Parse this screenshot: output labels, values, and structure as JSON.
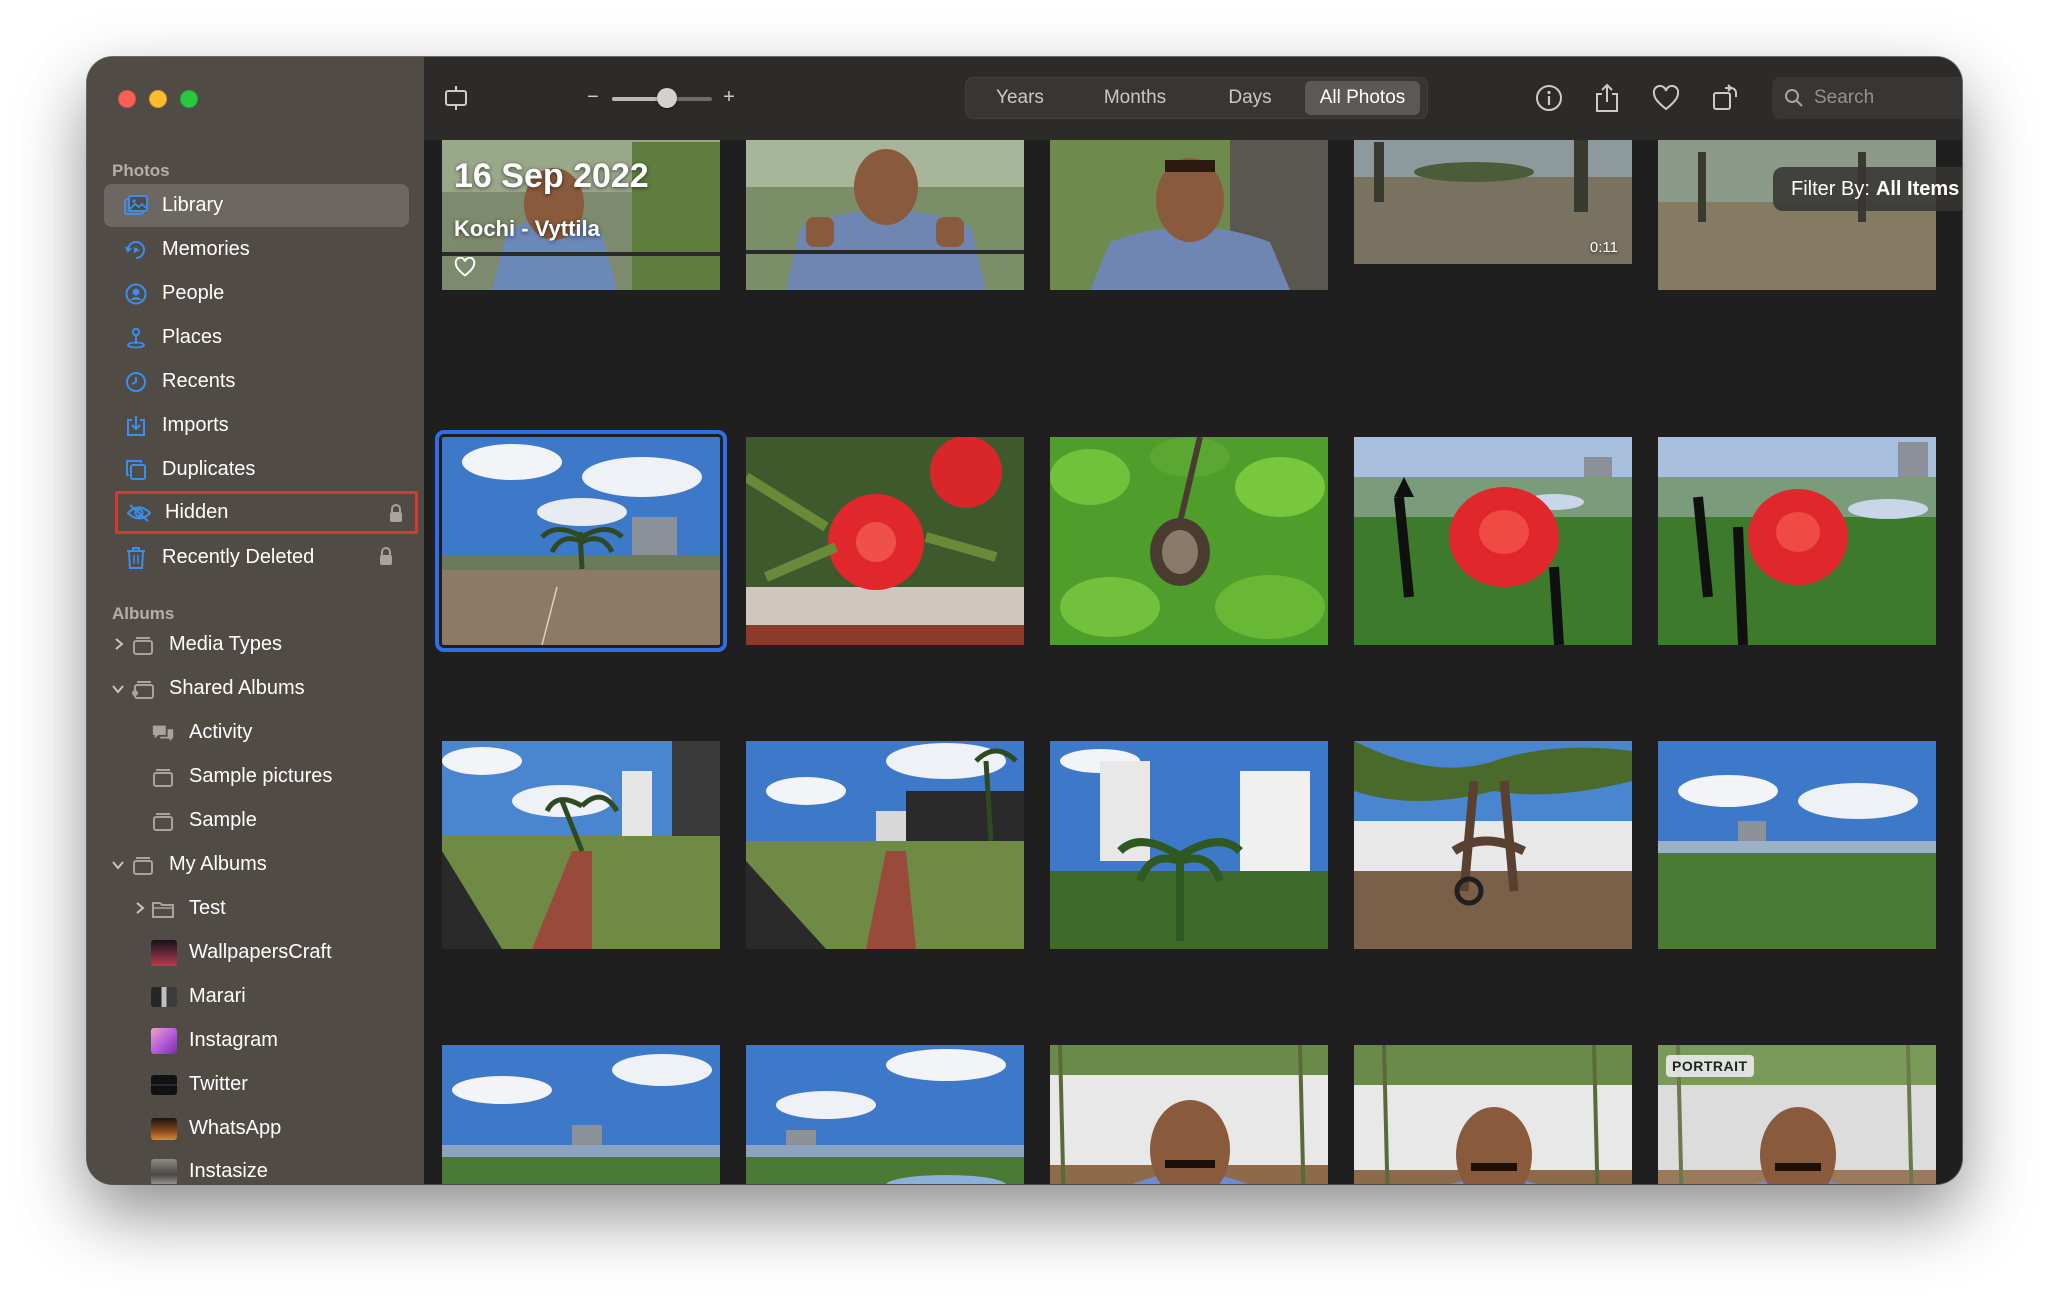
{
  "sidebar": {
    "photos_label": "Photos",
    "albums_label": "Albums",
    "photos_items": [
      {
        "label": "Library",
        "icon": "library-icon"
      },
      {
        "label": "Memories",
        "icon": "memories-icon"
      },
      {
        "label": "People",
        "icon": "people-icon"
      },
      {
        "label": "Places",
        "icon": "places-icon"
      },
      {
        "label": "Recents",
        "icon": "recents-icon"
      },
      {
        "label": "Imports",
        "icon": "imports-icon"
      },
      {
        "label": "Duplicates",
        "icon": "duplicates-icon"
      },
      {
        "label": "Hidden",
        "icon": "hidden-icon",
        "locked": true
      },
      {
        "label": "Recently Deleted",
        "icon": "trash-icon",
        "locked": true
      }
    ],
    "album_items": [
      {
        "label": "Media Types",
        "icon": "album-stack-icon",
        "expander": "collapsed"
      },
      {
        "label": "Shared Albums",
        "icon": "shared-album-icon",
        "expander": "expanded"
      },
      {
        "label": "Activity",
        "icon": "activity-icon"
      },
      {
        "label": "Sample pictures",
        "icon": "album-stack-icon"
      },
      {
        "label": "Sample",
        "icon": "album-stack-icon"
      },
      {
        "label": "My Albums",
        "icon": "album-stack-icon",
        "expander": "expanded"
      },
      {
        "label": "Test",
        "icon": "folder-icon",
        "expander": "collapsed"
      },
      {
        "label": "WallpapersCraft",
        "icon": "album-thumbnail"
      },
      {
        "label": "Marari",
        "icon": "album-thumbnail"
      },
      {
        "label": "Instagram",
        "icon": "album-thumbnail"
      },
      {
        "label": "Twitter",
        "icon": "album-thumbnail"
      },
      {
        "label": "WhatsApp",
        "icon": "album-thumbnail"
      },
      {
        "label": "Instasize",
        "icon": "album-thumbnail"
      }
    ]
  },
  "toolbar": {
    "zoom_minus": "−",
    "zoom_plus": "+",
    "zoom_level": 0.55,
    "view_tabs": [
      "Years",
      "Months",
      "Days",
      "All Photos"
    ],
    "active_tab": "All Photos",
    "search_placeholder": "Search"
  },
  "grid": {
    "header_date": "16 Sep 2022",
    "header_place": "Kochi - Vyttila",
    "video_duration": "0:11",
    "filter_label": "Filter By:",
    "filter_value": "All Items",
    "portrait_badge": "PORTRAIT"
  },
  "colors": {
    "accent_selection": "#2f6ee6",
    "highlight_outline": "#d8392d",
    "sidebar_icon": "#3a8ef0"
  }
}
